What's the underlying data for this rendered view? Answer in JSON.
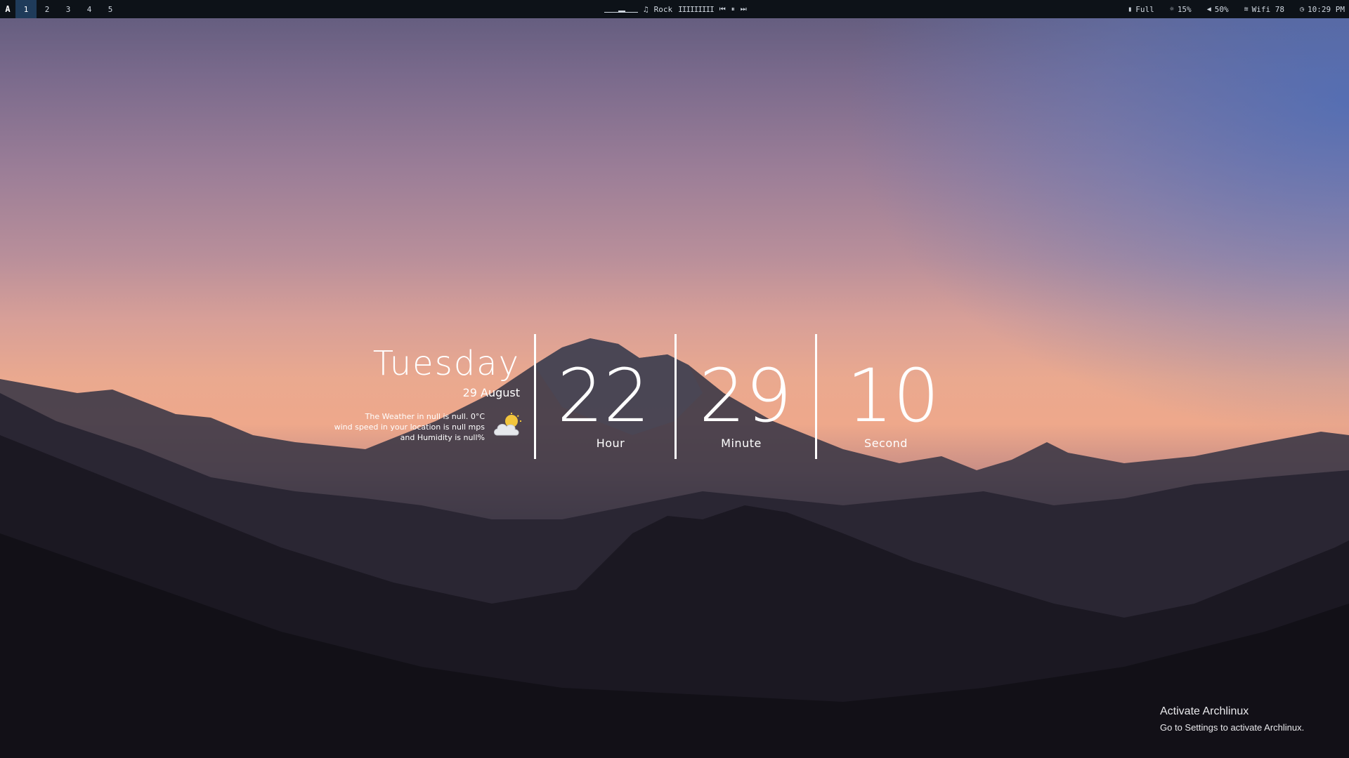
{
  "topbar": {
    "logo": "A",
    "workspaces": [
      "1",
      "2",
      "3",
      "4",
      "5"
    ],
    "active_workspace": "1",
    "music": {
      "icon": "music-note-icon",
      "label": "Rock",
      "bars": "IIIIIIIII"
    },
    "battery": "Full",
    "brightness": "15%",
    "volume": "50%",
    "wifi": "Wifi 78",
    "time": "10:29 PM"
  },
  "widget": {
    "day": "Tuesday",
    "date": "29 August",
    "weather_line1": "The Weather in null is null. 0°C",
    "weather_line2": "wind speed in your location is null mps",
    "weather_line3": "and Humidity is null%",
    "hour": "22",
    "minute": "29",
    "second": "10",
    "hour_label": "Hour",
    "minute_label": "Minute",
    "second_label": "Second"
  },
  "watermark": {
    "title": "Activate Archlinux",
    "subtitle": "Go to Settings to activate Archlinux."
  },
  "colors": {
    "bar_bg": "#0d1218",
    "active_ws": "#1f3b5a",
    "sky_peach": "#eea88b"
  }
}
